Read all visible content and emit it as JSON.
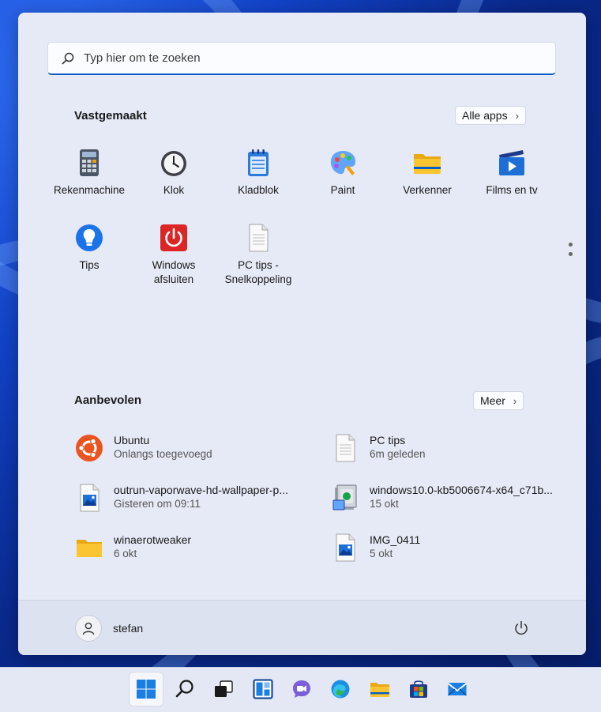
{
  "search": {
    "placeholder": "Typ hier om te zoeken"
  },
  "pinned": {
    "title": "Vastgemaakt",
    "all_apps_label": "Alle apps",
    "apps": [
      {
        "label": "Rekenmachine",
        "icon": "calculator-icon"
      },
      {
        "label": "Klok",
        "icon": "clock-icon"
      },
      {
        "label": "Kladblok",
        "icon": "notepad-icon"
      },
      {
        "label": "Paint",
        "icon": "paint-icon"
      },
      {
        "label": "Verkenner",
        "icon": "file-explorer-icon"
      },
      {
        "label": "Films en tv",
        "icon": "films-tv-icon"
      },
      {
        "label": "Tips",
        "icon": "tips-icon"
      },
      {
        "label": "Windows\nafsluiten",
        "icon": "shutdown-icon"
      },
      {
        "label": "PC tips -\nSnelkoppeling",
        "icon": "document-icon"
      }
    ]
  },
  "recommended": {
    "title": "Aanbevolen",
    "more_label": "Meer",
    "items": [
      {
        "title": "Ubuntu",
        "subtitle": "Onlangs toegevoegd",
        "icon": "ubuntu-icon"
      },
      {
        "title": "PC tips",
        "subtitle": "6m geleden",
        "icon": "document-icon"
      },
      {
        "title": "outrun-vaporwave-hd-wallpaper-p...",
        "subtitle": "Gisteren om 09:11",
        "icon": "image-file-icon"
      },
      {
        "title": "windows10.0-kb5006674-x64_c71b...",
        "subtitle": "15 okt",
        "icon": "installer-icon"
      },
      {
        "title": "winaerotweaker",
        "subtitle": "6 okt",
        "icon": "folder-icon"
      },
      {
        "title": "IMG_0411",
        "subtitle": "5 okt",
        "icon": "image-file-icon"
      }
    ]
  },
  "user": {
    "name": "stefan"
  },
  "taskbar": {
    "items": [
      "start-icon",
      "search-icon",
      "task-view-icon",
      "widgets-icon",
      "chat-icon",
      "edge-icon",
      "file-explorer-icon",
      "store-icon",
      "mail-icon"
    ]
  },
  "colors": {
    "accent": "#0a5ec2",
    "menu_bg": "#e6eaf7",
    "taskbar_bg": "#e3e8f4"
  }
}
